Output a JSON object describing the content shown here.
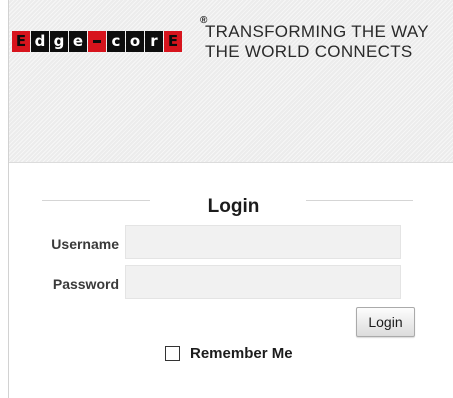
{
  "brand": {
    "logo_letters": [
      "E",
      "d",
      "g",
      "e",
      "-",
      "c",
      "o",
      "r",
      "E"
    ],
    "registered_mark": "®",
    "tagline_line1": "TRANSFORMING THE WAY",
    "tagline_line2": "THE WORLD CONNECTS"
  },
  "login": {
    "title": "Login",
    "username_label": "Username",
    "password_label": "Password",
    "username_value": "",
    "password_value": "",
    "submit_label": "Login",
    "remember_label": "Remember Me",
    "remember_checked": false
  },
  "colors": {
    "logo_red": "#d7141d",
    "logo_black": "#0d0d0d",
    "header_bg": "#ececec",
    "input_bg": "#f1f1f1"
  }
}
